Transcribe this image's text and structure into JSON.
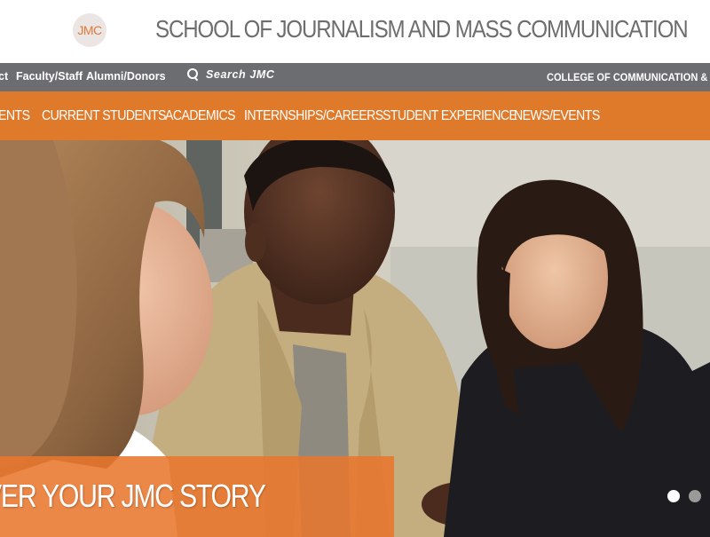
{
  "header": {
    "logo_text": "JMC",
    "title": "SCHOOL OF JOURNALISM AND MASS COMMUNICATION"
  },
  "utility_bar": {
    "links": [
      "ct",
      "Faculty/Staff",
      "Alumni/Donors"
    ],
    "search_placeholder": "Search JMC",
    "college": "COLLEGE OF COMMUNICATION & INF"
  },
  "main_nav": {
    "items": [
      "ENTS",
      "CURRENT STUDENTS",
      "ACADEMICS",
      "INTERNSHIPS/CAREERS",
      "STUDENT EXPERIENCE",
      "NEWS/EVENTS"
    ]
  },
  "hero": {
    "banner_text": "VER YOUR JMC STORY",
    "slide_count": 2,
    "active_slide": 1
  },
  "colors": {
    "accent": "#e07a2b",
    "utility_bar": "#6c6d70",
    "title_gray": "#6e6e6e"
  }
}
